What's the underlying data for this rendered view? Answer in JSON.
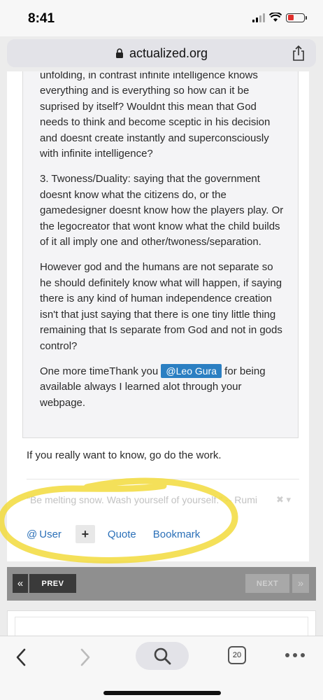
{
  "status_bar": {
    "time": "8:41",
    "battery_color": "#e0302c"
  },
  "browser": {
    "url": "actualized.org",
    "icons": [
      "lock-icon",
      "share-icon"
    ]
  },
  "post": {
    "quote_paragraphs": [
      "unfolding, in contrast infinite intelligence knows everything and is everything so how can it be suprised by itself?  Wouldnt this mean that God needs to think and become sceptic in his decision and doesnt create instantly and superconsciously with infinite intelligence?",
      "3. Twoness/Duality: saying that the government doesnt know what the citizens do, or the gamedesigner doesnt know how the players play. Or the legocreator that wont know what the child builds of it all imply one and other/twoness/separation.",
      "However god and the humans are not separate so he should definitely know what will happen, if saying there is any kind of human independence creation isn't that just saying that there is one tiny little thing remaining that Is separate from God and not in gods control?"
    ],
    "thanks_before": "One more timeThank you ",
    "mention": "@Leo Gura",
    "thanks_after": " for being available always I learned alot through your webpage.",
    "answer": "If you really want to know, go do the work.",
    "signature": "\"Be melting snow. Wash yourself of yourself.\" -- Rumi",
    "actions": {
      "user": "User",
      "plus": "+",
      "quote": "Quote",
      "bookmark": "Bookmark"
    },
    "highlight_color": "#f2da3c"
  },
  "pagination": {
    "first_icon": "«",
    "prev": "PREV",
    "next": "NEXT",
    "last_icon": "»"
  },
  "toolbar": {
    "tabs_count": "20",
    "icons": [
      "back-icon",
      "forward-icon",
      "search-icon",
      "tabs-icon",
      "more-icon"
    ]
  },
  "colors": {
    "link": "#2b70b8",
    "mention_bg": "#2b7fc2",
    "pager_bg": "#8f8f8f"
  }
}
